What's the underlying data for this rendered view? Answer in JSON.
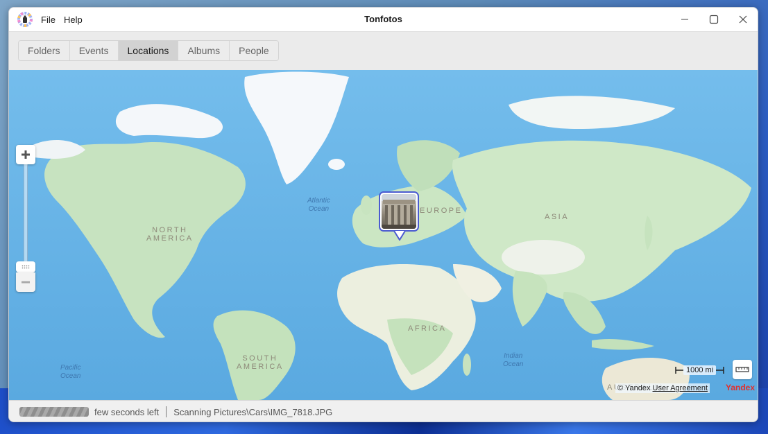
{
  "window": {
    "title": "Tonfotos",
    "menu": [
      {
        "label": "File"
      },
      {
        "label": "Help"
      }
    ],
    "controls": [
      "minimize-icon",
      "maximize-icon",
      "close-icon"
    ]
  },
  "tabs": [
    {
      "label": "Folders",
      "active": false
    },
    {
      "label": "Events",
      "active": false
    },
    {
      "label": "Locations",
      "active": true
    },
    {
      "label": "Albums",
      "active": false
    },
    {
      "label": "People",
      "active": false
    }
  ],
  "map": {
    "continent_labels": {
      "north_america": "NORTH\nAMERICA",
      "south_america": "SOUTH\nAMERICA",
      "europe": "EUROPE",
      "asia": "ASIA",
      "africa": "AFRICA",
      "australia": "AUSTRALIA"
    },
    "ocean_labels": {
      "atlantic": "Atlantic\nOcean",
      "pacific": "Pacific\nOcean",
      "indian": "Indian\nOcean"
    },
    "zoom_in_icon": "plus-icon",
    "zoom_out_icon": "minus-icon",
    "scale_label": "1000 mi",
    "ruler_icon": "ruler-icon",
    "copyright": "© Yandex",
    "user_agreement": "User Agreement",
    "provider_logo": "Yandex",
    "marker": {
      "kind": "photo-thumbnail",
      "location": "Europe (Rome)"
    },
    "colors": {
      "water": "#62b1e6",
      "land": "#cfe7c7",
      "ice": "#f4f7fa",
      "marker_border": "#4b5bd1"
    }
  },
  "status": {
    "progress_label": "few seconds left",
    "scan_text": "Scanning Pictures\\Cars\\IMG_7818.JPG"
  }
}
